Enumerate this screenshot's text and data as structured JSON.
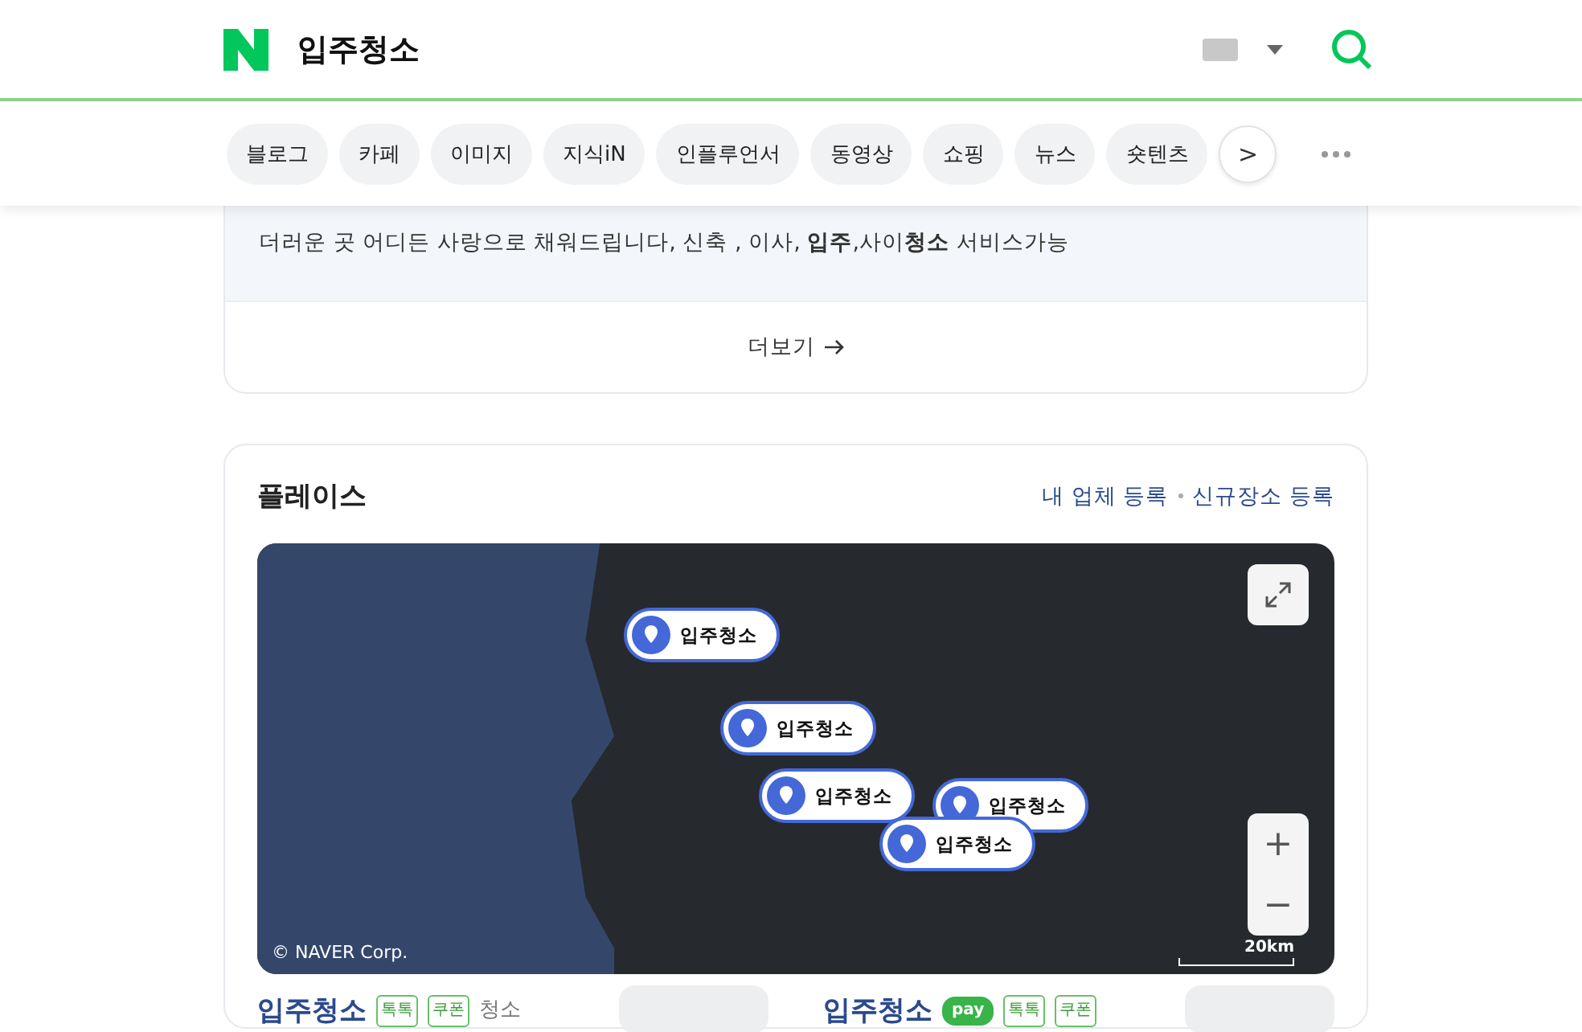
{
  "search": {
    "value": "입주청소"
  },
  "tabs": [
    {
      "label": "블로그"
    },
    {
      "label": "카페"
    },
    {
      "label": "이미지"
    },
    {
      "label": "지식iN"
    },
    {
      "label": "인플루언서"
    },
    {
      "label": "동영상"
    },
    {
      "label": "쇼핑"
    },
    {
      "label": "뉴스"
    },
    {
      "label": "숏텐츠"
    }
  ],
  "tabs_more": ">",
  "ad_card": {
    "description": "더러운 곳 어디든 사랑으로 채워드립니다, 신축 , 이사, **입주**,사이**청소** 서비스가능",
    "more": "더보기"
  },
  "places": {
    "title": "플레이스",
    "links": [
      "내 업체 등록",
      "신규장소 등록"
    ],
    "map": {
      "pins": [
        {
          "label": "입주청소"
        },
        {
          "label": "입주청소"
        },
        {
          "label": "입주청소"
        },
        {
          "label": "입주청소"
        },
        {
          "label": "입주청소"
        }
      ],
      "copyright": "© NAVER Corp.",
      "scale": "20km",
      "zoom_in": "+",
      "zoom_out": "−"
    },
    "results": [
      {
        "title": "입주청소",
        "badges": [
          "톡톡",
          "쿠폰"
        ],
        "category": "청소"
      },
      {
        "title": "입주청소",
        "pay_badge": "pay",
        "badges": [
          "톡톡",
          "쿠폰"
        ]
      }
    ]
  }
}
